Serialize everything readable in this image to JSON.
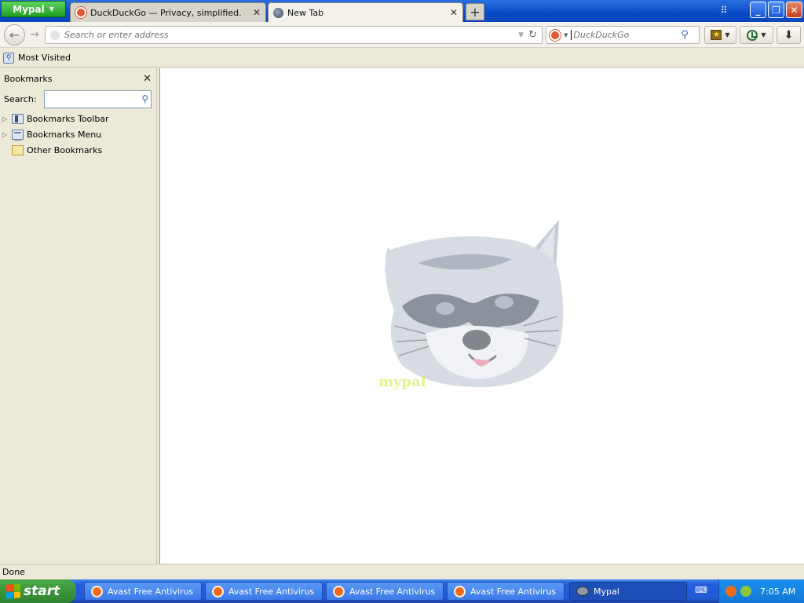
{
  "app_menu": {
    "label": "Mypal"
  },
  "tabs": [
    {
      "title": "DuckDuckGo — Privacy, simplified.",
      "favicon": "duckduckgo-favicon",
      "active": false
    },
    {
      "title": "New Tab",
      "favicon": "globe-icon",
      "active": true
    }
  ],
  "navbar": {
    "address_placeholder": "Search or enter address",
    "search_placeholder": "DuckDuckGo"
  },
  "bookmarks_toolbar": {
    "items": [
      {
        "label": "Most Visited",
        "icon": "most-visited-icon"
      }
    ]
  },
  "sidebar": {
    "title": "Bookmarks",
    "search_label": "Search:",
    "items": [
      {
        "label": "Bookmarks Toolbar",
        "icon": "bookmarks-toolbar-folder-icon",
        "expandable": true
      },
      {
        "label": "Bookmarks Menu",
        "icon": "bookmarks-menu-folder-icon",
        "expandable": true
      },
      {
        "label": "Other Bookmarks",
        "icon": "other-bookmarks-folder-icon",
        "expandable": false
      }
    ]
  },
  "content": {
    "logo_text": "mypal"
  },
  "statusbar": {
    "text": "Done"
  },
  "taskbar": {
    "start_label": "start",
    "tasks": [
      {
        "label": "Avast Free Antivirus",
        "icon": "avast-icon"
      },
      {
        "label": "Avast Free Antivirus",
        "icon": "avast-icon"
      },
      {
        "label": "Avast Free Antivirus",
        "icon": "avast-icon"
      },
      {
        "label": "Avast Free Antivirus",
        "icon": "avast-icon"
      },
      {
        "label": "Mypal",
        "icon": "mypal-icon"
      }
    ],
    "clock": "7:05 AM"
  },
  "colors": {
    "titlebar": "#0a4bc8",
    "app_menu": "#1f9f1f",
    "taskbar": "#245edb",
    "start_button": "#3c9a3c"
  }
}
